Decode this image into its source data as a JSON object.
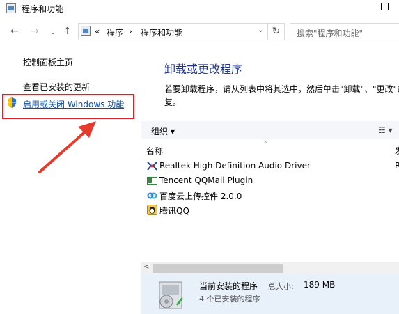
{
  "window": {
    "title": "程序和功能"
  },
  "nav": {
    "back": "←",
    "forward": "→",
    "recent": "⌄",
    "up": "↑",
    "breadcrumb_sep": "«",
    "crumbs": [
      "程序",
      "程序和功能"
    ],
    "crumb_arrow": "›",
    "dropdown": "⌄",
    "refresh": "↻",
    "search_placeholder": "搜索\"程序和功能\""
  },
  "sidebar": {
    "home": "控制面板主页",
    "updates": "查看已安装的更新",
    "windows_features": "启用或关闭 Windows 功能"
  },
  "main": {
    "heading": "卸载或更改程序",
    "description_line1": "若要卸载程序，请从列表中将其选中，然后单击\"卸载\"、\"更改\"或",
    "description_line2": "复。",
    "organize": "组织 ▾",
    "view": "☷ ▾",
    "col_name": "名称",
    "col_publisher": "发",
    "sort_indicator": "^"
  },
  "programs": [
    {
      "name": "Realtek High Definition Audio Driver",
      "icon": "realtek-audio-icon",
      "publisher_initial": "R"
    },
    {
      "name": "Tencent QQMail Plugin",
      "icon": "qqmail-icon",
      "publisher_initial": ""
    },
    {
      "name": "百度云上传控件 2.0.0",
      "icon": "baidu-cloud-icon",
      "publisher_initial": ""
    },
    {
      "name": "腾讯QQ",
      "icon": "qq-icon",
      "publisher_initial": ""
    }
  ],
  "scroll": {
    "left_arrow": "<"
  },
  "details": {
    "title": "当前安装的程序",
    "size_label": "总大小:",
    "size_value": "189 MB",
    "count": "4 个已安装的程序"
  },
  "colors": {
    "heading": "#1e3287",
    "link": "#0a52a8",
    "highlight_box": "#e02020",
    "details_bg": "#e8f0fa"
  }
}
